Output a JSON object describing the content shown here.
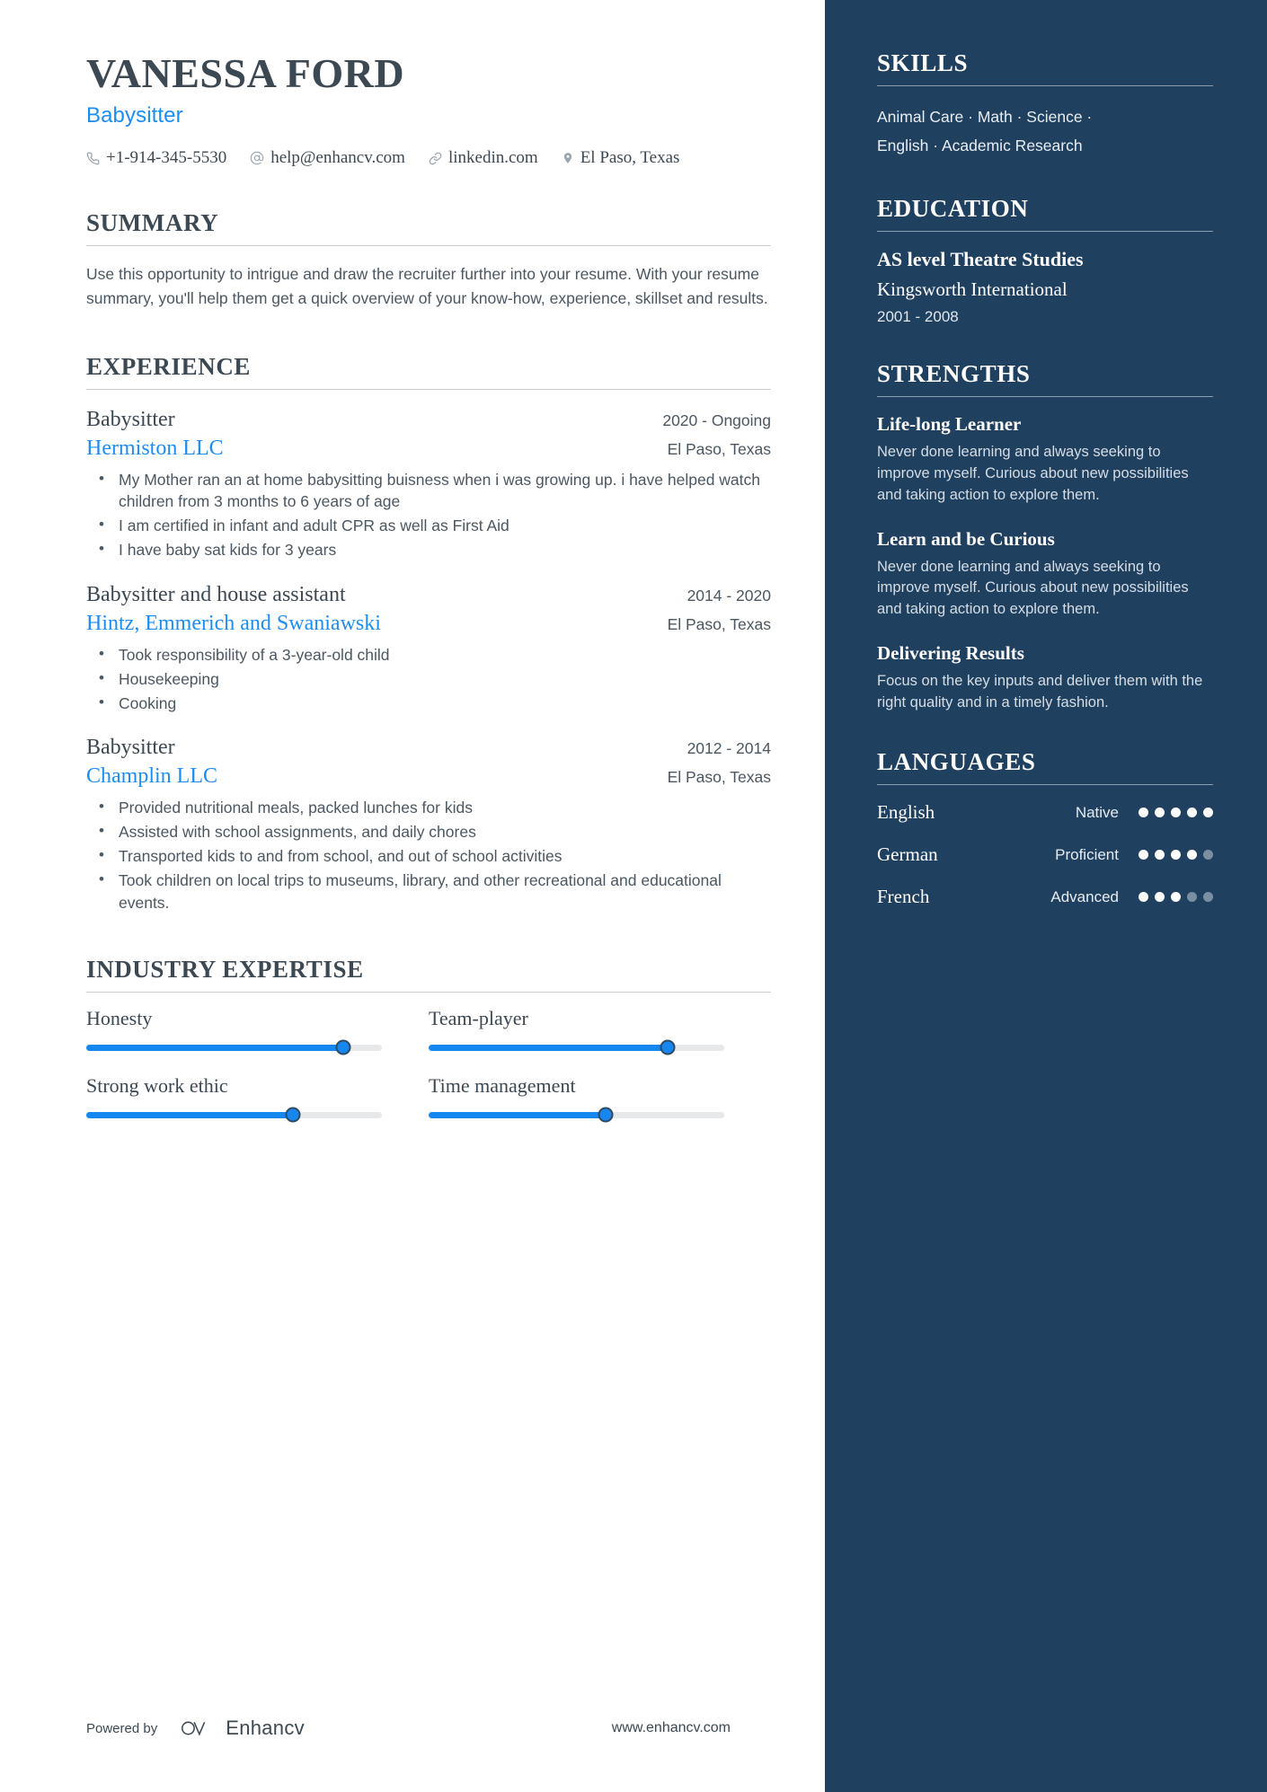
{
  "colors": {
    "accent_blue": "#1d8df2",
    "sidebar_bg": "#20405f",
    "text_dark": "#3c4852",
    "slider_fill": "#1787f0"
  },
  "header": {
    "name": "VANESSA FORD",
    "job_title": "Babysitter",
    "contacts": [
      {
        "icon": "phone-icon",
        "text": "+1-914-345-5530"
      },
      {
        "icon": "email-icon",
        "text": "help@enhancv.com"
      },
      {
        "icon": "link-icon",
        "text": "linkedin.com"
      },
      {
        "icon": "location-pin-icon",
        "text": "El Paso, Texas"
      }
    ]
  },
  "summary": {
    "title": "SUMMARY",
    "text": "Use this opportunity to intrigue and draw the recruiter further into your resume. With your resume summary, you'll help them get a quick overview of your know-how, experience, skillset and results."
  },
  "experience": {
    "title": "EXPERIENCE",
    "items": [
      {
        "role": "Babysitter",
        "date": "2020 - Ongoing",
        "company": "Hermiston LLC",
        "location": "El Paso, Texas",
        "bullets": [
          "My Mother ran an at home babysitting buisness when i was growing up. i have helped watch children from 3 months to 6 years of age",
          " I am certified in infant and adult CPR as well as First Aid",
          "I have baby sat kids for 3 years"
        ]
      },
      {
        "role": "Babysitter and house assistant",
        "date": "2014 - 2020",
        "company": "Hintz, Emmerich and Swaniawski",
        "location": "El Paso, Texas",
        "bullets": [
          "Took responsibility of a 3-year-old child",
          "Housekeeping",
          "Cooking"
        ]
      },
      {
        "role": "Babysitter",
        "date": "2012 - 2014",
        "company": "Champlin LLC",
        "location": "El Paso, Texas",
        "bullets": [
          "Provided nutritional meals, packed lunches for kids",
          "Assisted with school assignments, and daily chores",
          "Transported kids to and from school, and out of school activities",
          "Took children on local trips to museums, library, and other recreational and educational events."
        ]
      }
    ]
  },
  "industry_expertise": {
    "title": "INDUSTRY EXPERTISE",
    "items": [
      {
        "label": "Honesty",
        "value": 87
      },
      {
        "label": "Team-player",
        "value": 81
      },
      {
        "label": "Strong work ethic",
        "value": 70
      },
      {
        "label": "Time management",
        "value": 60
      }
    ]
  },
  "footer": {
    "powered_by": "Powered by",
    "brand": "Enhancv",
    "website": "www.enhancv.com"
  },
  "sidebar": {
    "skills": {
      "title": "SKILLS",
      "lines": [
        "Animal Care · Math · Science ·",
        "English · Academic Research"
      ]
    },
    "education": {
      "title": "EDUCATION",
      "degree": "AS level Theatre Studies",
      "school": "Kingsworth International",
      "date": "2001 - 2008"
    },
    "strengths": {
      "title": "STRENGTHS",
      "items": [
        {
          "title": "Life-long Learner",
          "description": "Never done learning and always seeking to improve myself. Curious about new possibilities and taking action to explore them."
        },
        {
          "title": "Learn and be Curious",
          "description": "Never done learning and always seeking to improve myself. Curious about new possibilities and taking action to explore them."
        },
        {
          "title": "Delivering Results",
          "description": "Focus on the key inputs and deliver them with the right quality and in a timely fashion."
        }
      ]
    },
    "languages": {
      "title": "LANGUAGES",
      "max_dots": 5,
      "items": [
        {
          "name": "English",
          "level": "Native",
          "dots": 5
        },
        {
          "name": "German",
          "level": "Proficient",
          "dots": 4
        },
        {
          "name": "French",
          "level": "Advanced",
          "dots": 3
        }
      ]
    }
  }
}
